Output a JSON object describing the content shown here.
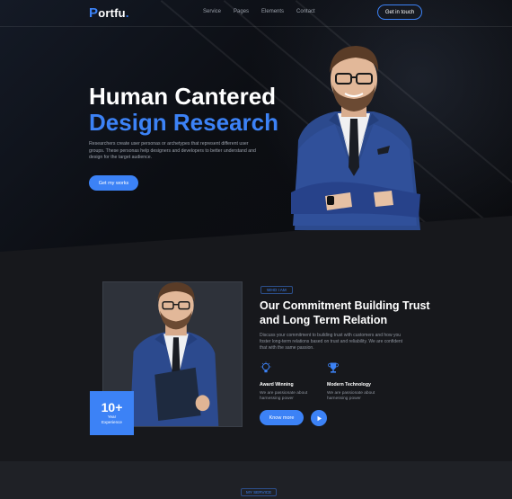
{
  "brand": {
    "logo_first": "P",
    "logo_rest": "ortfu",
    "logo_dot": "."
  },
  "nav": {
    "items": [
      "Service",
      "Pages",
      "Elements",
      "Contact"
    ],
    "cta": "Get in touch"
  },
  "hero": {
    "title_line1": "Human Cantered",
    "title_line2": "Design Research",
    "description": "Researchers create user personas or archetypes that represent different user groups. These personas help designers and developers to better understand and design for the target audience.",
    "button": "Get my works"
  },
  "about": {
    "badge": "WHO I AM",
    "title": "Our Commitment Building Trust and Long Term Relation",
    "description": "Discuss your commitment to building trust with customers and how you foster long-term relations based on trust and reliability. We are confident that with the same passion.",
    "experience_number": "10+",
    "experience_label": "Year Experience",
    "features": [
      {
        "icon": "lightbulb-icon",
        "title": "Award Winning",
        "desc": "We are passionate about harnessing power"
      },
      {
        "icon": "trophy-icon",
        "title": "Modern Technology",
        "desc": "We are passionate about harnessing power"
      }
    ],
    "button": "Know more"
  },
  "service": {
    "badge": "MY SERVICE"
  },
  "colors": {
    "accent": "#3c82f6",
    "background": "#17181c",
    "hero_bg": "#0c0e13"
  }
}
